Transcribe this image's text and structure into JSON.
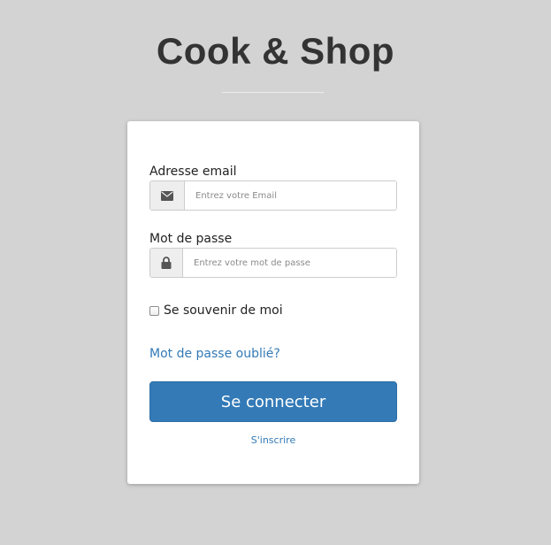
{
  "app": {
    "title": "Cook & Shop"
  },
  "login_form": {
    "email": {
      "label": "Adresse email",
      "placeholder": "Entrez votre Email",
      "value": "",
      "icon": "envelope-icon"
    },
    "password": {
      "label": "Mot de passe",
      "placeholder": "Entrez votre mot de passe",
      "value": "",
      "icon": "lock-icon"
    },
    "remember_me": {
      "label": "Se souvenir de moi",
      "checked": false
    },
    "forgot_password_link": "Mot de passe oublié?",
    "submit_label": "Se connecter",
    "signup_link": "S'inscrire"
  },
  "colors": {
    "background": "#d3d3d3",
    "card": "#ffffff",
    "primary": "#337ab7",
    "title_text": "#333333"
  }
}
